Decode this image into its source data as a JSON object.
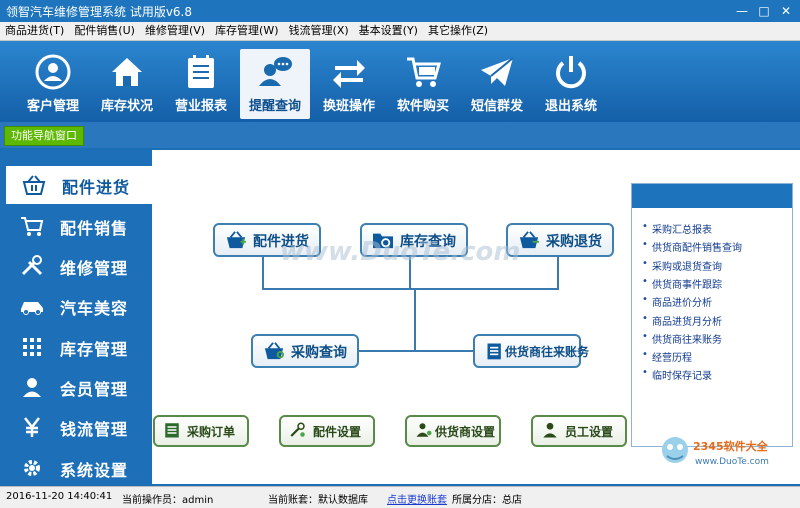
{
  "window": {
    "title": "领智汽车维修管理系统 试用版v6.8"
  },
  "menu": [
    "商品进货(T)",
    "配件销售(U)",
    "维修管理(V)",
    "库存管理(W)",
    "钱流管理(X)",
    "基本设置(Y)",
    "其它操作(Z)"
  ],
  "toolbar": [
    {
      "label": "客户管理",
      "icon": "customer-icon"
    },
    {
      "label": "库存状况",
      "icon": "home-icon"
    },
    {
      "label": "营业报表",
      "icon": "report-icon"
    },
    {
      "label": "提醒查询",
      "icon": "reminder-icon",
      "active": true
    },
    {
      "label": "换班操作",
      "icon": "swap-icon"
    },
    {
      "label": "软件购买",
      "icon": "cart-icon"
    },
    {
      "label": "短信群发",
      "icon": "mail-icon"
    },
    {
      "label": "退出系统",
      "icon": "power-icon"
    }
  ],
  "nav_tab": "功能导航窗口",
  "sidebar": [
    {
      "label": "配件进货",
      "icon": "basket-icon",
      "active": true
    },
    {
      "label": "配件销售",
      "icon": "cart-icon"
    },
    {
      "label": "维修管理",
      "icon": "tools-icon"
    },
    {
      "label": "汽车美容",
      "icon": "car-icon"
    },
    {
      "label": "库存管理",
      "icon": "grid-icon"
    },
    {
      "label": "会员管理",
      "icon": "user-icon"
    },
    {
      "label": "钱流管理",
      "icon": "yen-icon"
    },
    {
      "label": "系统设置",
      "icon": "gear-icon"
    }
  ],
  "flow": {
    "purchase": "配件进货",
    "stock_query": "库存查询",
    "purchase_return": "采购退货",
    "purchase_query": "采购查询",
    "supplier_account": "供货商往来账务"
  },
  "bottom_buttons": [
    "采购订单",
    "配件设置",
    "供货商设置",
    "员工设置"
  ],
  "right_panel": [
    "采购汇总报表",
    "供货商配件销售查询",
    "采购或退货查询",
    "供货商事件跟踪",
    "商品进价分析",
    "商品进货月分析",
    "供货商往来账务",
    "经营历程",
    "临时保存记录"
  ],
  "watermark": "www.DuoTe.com",
  "status": {
    "datetime": "2016-11-20 14:40:41",
    "operator": "当前操作员：admin",
    "account": "当前账套：默认数据库",
    "switch_link": "点击更换账套",
    "branch": "所属分店：总店"
  },
  "colors": {
    "accent": "#1e75bd",
    "nav_green": "#5cb800"
  }
}
